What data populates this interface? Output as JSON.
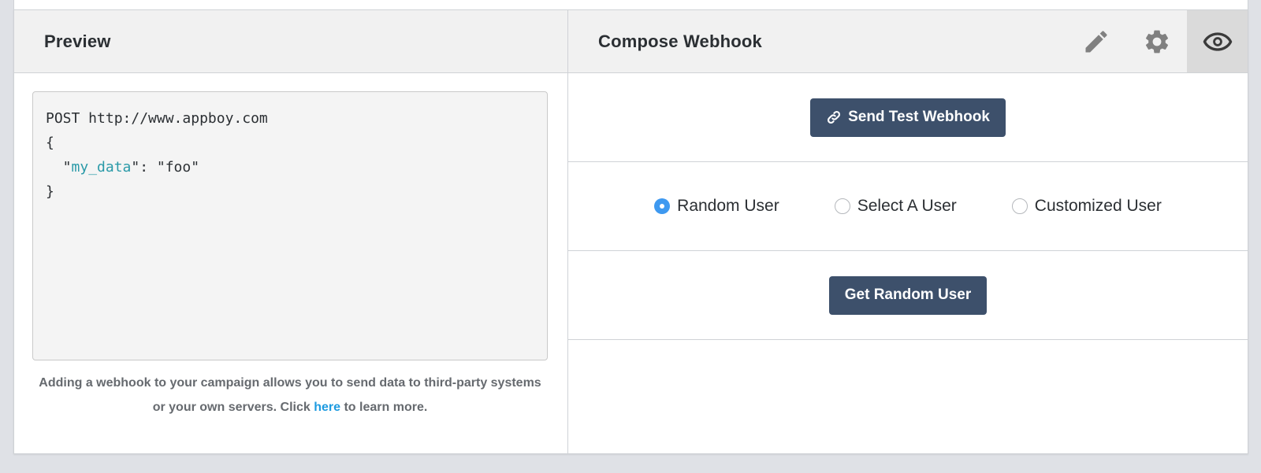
{
  "preview": {
    "title": "Preview",
    "code": {
      "line1": "POST http://www.appboy.com",
      "line2": "{",
      "line3_indent": "  \"",
      "line3_key": "my_data",
      "line3_rest": "\": \"foo\"",
      "line4": "}"
    },
    "helper": {
      "text_before": "Adding a webhook to your campaign allows you to send data to third-party systems or your own servers. Click ",
      "link": "here",
      "text_after": " to learn more."
    }
  },
  "compose": {
    "title": "Compose Webhook",
    "icons": [
      "pencil-icon",
      "gear-icon",
      "eye-icon"
    ],
    "send_test_label": "Send Test Webhook",
    "radio_options": [
      {
        "label": "Random User",
        "checked": true
      },
      {
        "label": "Select A User",
        "checked": false
      },
      {
        "label": "Customized User",
        "checked": false
      }
    ],
    "get_user_label": "Get Random User"
  },
  "colors": {
    "button_bg": "#3d506b",
    "radio_accent": "#3e99f0",
    "link": "#1e9be0",
    "code_key": "#2a9aa8"
  }
}
